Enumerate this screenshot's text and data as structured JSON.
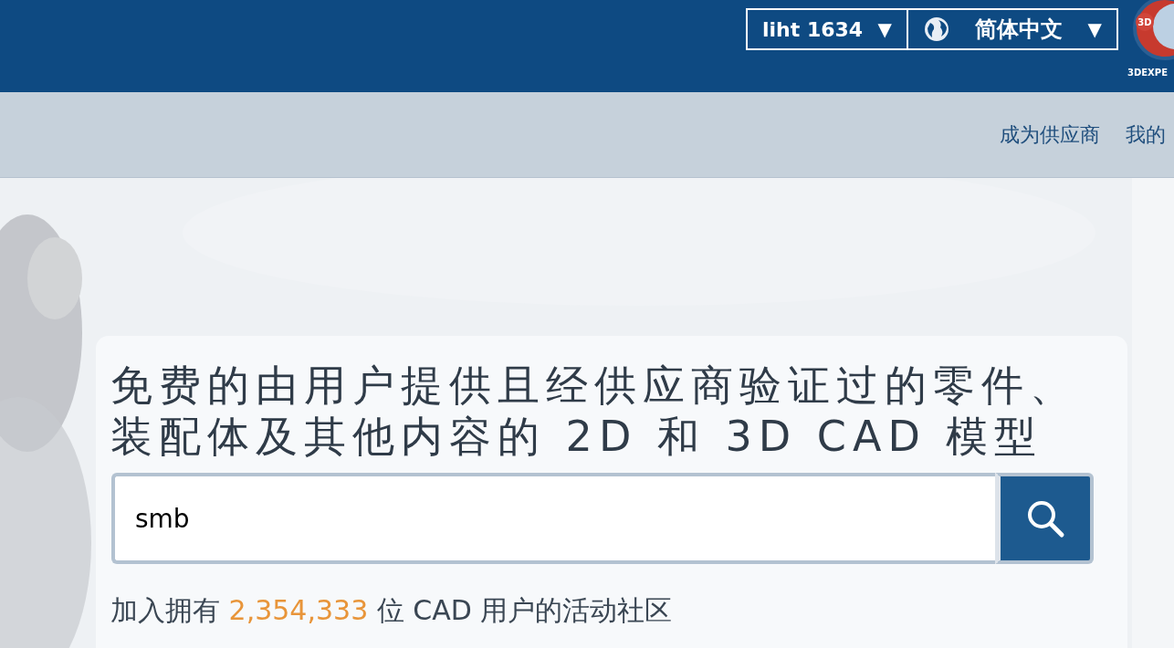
{
  "header": {
    "account_menu": {
      "label": "liht 1634",
      "caret": "▼"
    },
    "language_menu": {
      "label": "简体中文",
      "caret": "▼"
    },
    "logo": {
      "badge": "3D",
      "caption": "3DEXPE"
    }
  },
  "subnav": {
    "links": [
      "成为供应商",
      "我的"
    ]
  },
  "hero": {
    "kind": "picture",
    "heading": "免费的由用户提供且经供应商验证过的零件、装配体及其他内容的 2D 和 3D CAD 模型",
    "search": {
      "value": "smb"
    },
    "community": {
      "before": "加入拥有",
      "count": "2,354,333",
      "after": "位 CAD 用户的活动社区"
    }
  }
}
